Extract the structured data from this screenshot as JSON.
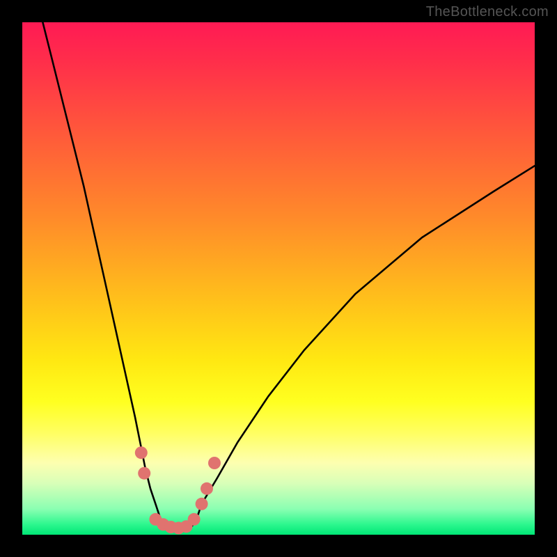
{
  "watermark": "TheBottleneck.com",
  "chart_data": {
    "type": "line",
    "title": "",
    "xlabel": "",
    "ylabel": "",
    "xlim": [
      0,
      100
    ],
    "ylim": [
      0,
      100
    ],
    "series": [
      {
        "name": "bottleneck-curve",
        "x": [
          4,
          6,
          8,
          10,
          12,
          14,
          16,
          18,
          20,
          22,
          23,
          24,
          25,
          26,
          27,
          28,
          29,
          30,
          31,
          32,
          33,
          34,
          35,
          38,
          42,
          48,
          55,
          65,
          78,
          92,
          100
        ],
        "y": [
          100,
          92,
          84,
          76,
          68,
          59,
          50,
          41,
          32,
          23,
          18,
          13,
          9,
          6,
          3,
          2,
          1.5,
          1.2,
          1,
          1.2,
          1.5,
          3,
          6,
          11,
          18,
          27,
          36,
          47,
          58,
          67,
          72
        ]
      }
    ],
    "markers": {
      "name": "highlight-dots",
      "color": "#e0736f",
      "points": [
        {
          "x": 23.2,
          "y": 16
        },
        {
          "x": 23.8,
          "y": 12
        },
        {
          "x": 26.0,
          "y": 3.0
        },
        {
          "x": 27.5,
          "y": 2.0
        },
        {
          "x": 29.0,
          "y": 1.5
        },
        {
          "x": 30.5,
          "y": 1.3
        },
        {
          "x": 32.0,
          "y": 1.6
        },
        {
          "x": 33.5,
          "y": 3.0
        },
        {
          "x": 35.0,
          "y": 6.0
        },
        {
          "x": 36.0,
          "y": 9.0
        },
        {
          "x": 37.5,
          "y": 14.0
        }
      ]
    },
    "background_gradient": {
      "top": "#ff1a54",
      "mid": "#ffe812",
      "bottom": "#00e676"
    }
  }
}
